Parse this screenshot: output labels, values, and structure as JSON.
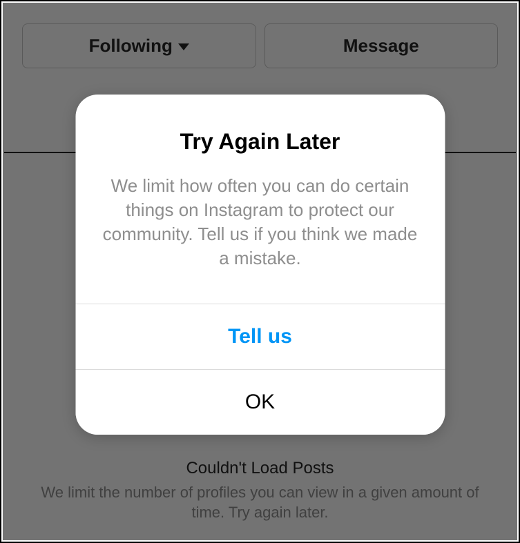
{
  "profile_actions": {
    "following_label": "Following",
    "message_label": "Message"
  },
  "background_error": {
    "title": "Couldn't Load Posts",
    "message": "We limit the number of profiles you can view in a given amount of time. Try again later."
  },
  "modal": {
    "title": "Try Again Later",
    "body": "We limit how often you can do certain things on Instagram to protect our community. Tell us if you think we made a mistake.",
    "primary_button": "Tell us",
    "secondary_button": "OK"
  }
}
